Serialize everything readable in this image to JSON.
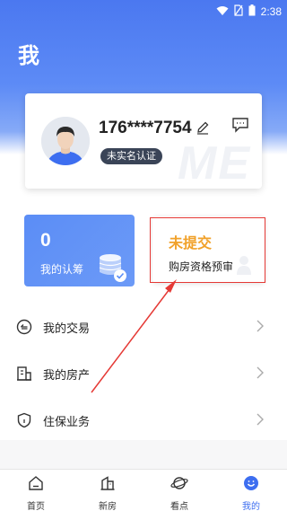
{
  "status_bar": {
    "time": "2:38"
  },
  "header": {
    "title": "我"
  },
  "profile": {
    "phone": "176****7754",
    "verify_status": "未实名认证",
    "watermark": "ME"
  },
  "certification": {
    "count": "0",
    "label": "我的认筹"
  },
  "qualification": {
    "status": "未提交",
    "label": "购房资格预审"
  },
  "menu": [
    {
      "label": "我的交易",
      "icon": "transaction-icon"
    },
    {
      "label": "我的房产",
      "icon": "building-icon"
    },
    {
      "label": "住保业务",
      "icon": "shield-icon"
    }
  ],
  "nav": [
    {
      "label": "首页",
      "icon": "home-icon"
    },
    {
      "label": "新房",
      "icon": "new-house-icon"
    },
    {
      "label": "看点",
      "icon": "planet-icon"
    },
    {
      "label": "我的",
      "icon": "profile-face-icon",
      "active": true
    }
  ],
  "colors": {
    "primary": "#3d6ef0",
    "header_gradient": "#4b78f0",
    "status_orange": "#f1a12a",
    "highlight_red": "#e53935"
  }
}
